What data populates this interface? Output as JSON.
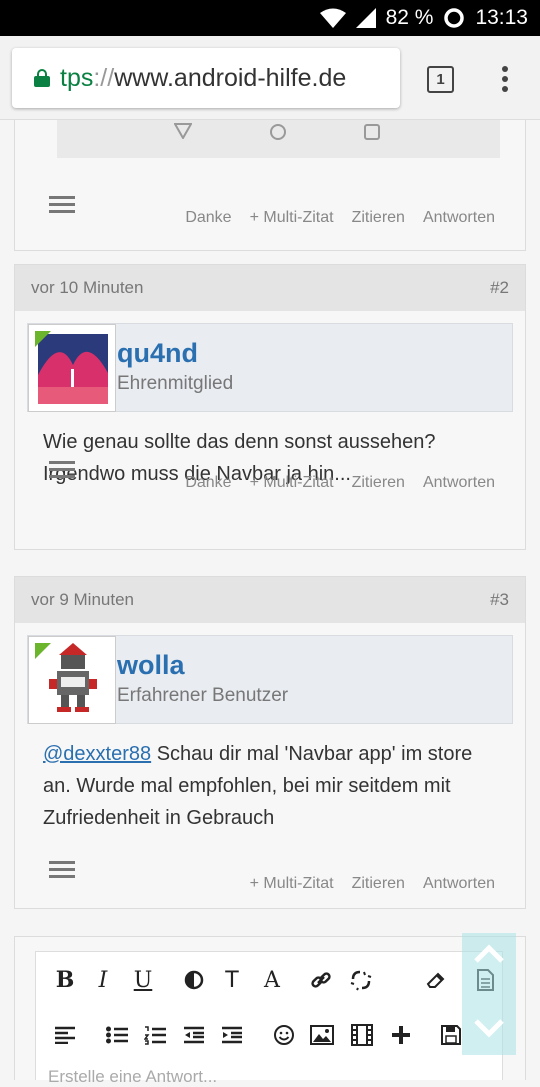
{
  "status": {
    "battery": "82 %",
    "time": "13:13"
  },
  "browser": {
    "scheme": "tps",
    "sep": "://",
    "host": "www.android-hilfe.de",
    "tab_count": "1"
  },
  "post1": {
    "actions": [
      "Danke",
      "+ Multi-Zitat",
      "Zitieren",
      "Antworten"
    ]
  },
  "post2": {
    "time": "vor 10 Minuten",
    "num": "#2",
    "user": "qu4nd",
    "role": "Ehrenmitglied",
    "text": "Wie genau sollte das denn sonst aussehen? Irgendwo muss die Navbar ja hin...",
    "actions": [
      "Danke",
      "+ Multi-Zitat",
      "Zitieren",
      "Antworten"
    ]
  },
  "post3": {
    "time": "vor 9 Minuten",
    "num": "#3",
    "user": "wolla",
    "role": "Erfahrener Benutzer",
    "mention": "@dexxter88",
    "text": " Schau dir mal 'Navbar app' im store an. Wurde mal empfohlen, bei mir seitdem mit Zufriedenheit in Gebrauch",
    "actions": [
      "+ Multi-Zitat",
      "Zitieren",
      "Antworten"
    ]
  },
  "editor": {
    "bold": "B",
    "italic": "I",
    "underline": "U",
    "font": "A",
    "size": "T",
    "placeholder": "Erstelle eine Antwort..."
  }
}
